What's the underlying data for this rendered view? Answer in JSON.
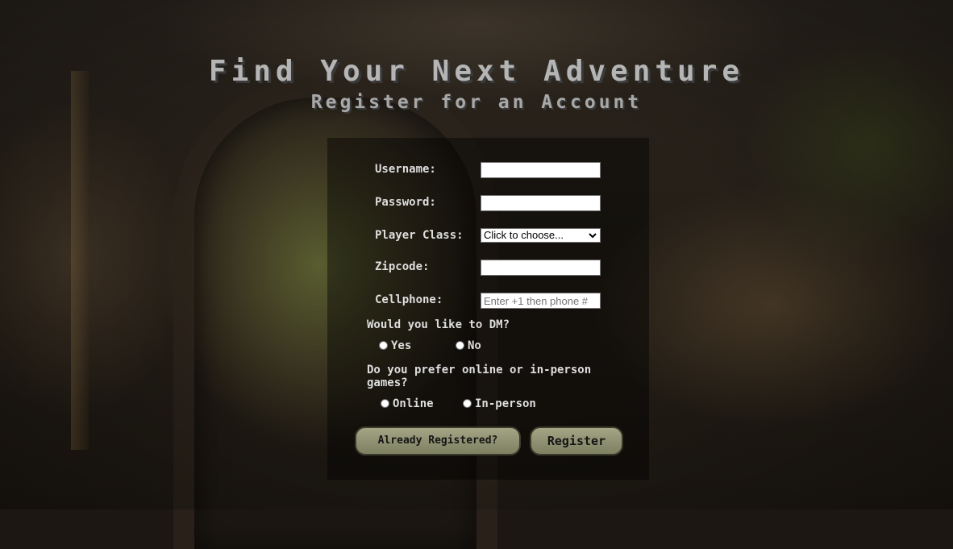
{
  "header": {
    "title": "Find Your Next Adventure",
    "subtitle": "Register for an Account"
  },
  "form": {
    "username": {
      "label": "Username:",
      "value": ""
    },
    "password": {
      "label": "Password:",
      "value": ""
    },
    "player_class": {
      "label": "Player Class:",
      "selected": "Click to choose..."
    },
    "zipcode": {
      "label": "Zipcode:",
      "value": ""
    },
    "cellphone": {
      "label": "Cellphone:",
      "value": "",
      "placeholder": "Enter +1 then phone #"
    },
    "dm_question": {
      "text": "Would you like to DM?",
      "options": [
        "Yes",
        "No"
      ]
    },
    "game_type_question": {
      "text": "Do you prefer online or in-person games?",
      "options": [
        "Online",
        "In-person"
      ]
    }
  },
  "buttons": {
    "already_registered": "Already Registered?",
    "register": "Register"
  },
  "colors": {
    "button_fill": "#8e9071",
    "text": "#dedede",
    "title": "#b5b5b5"
  }
}
